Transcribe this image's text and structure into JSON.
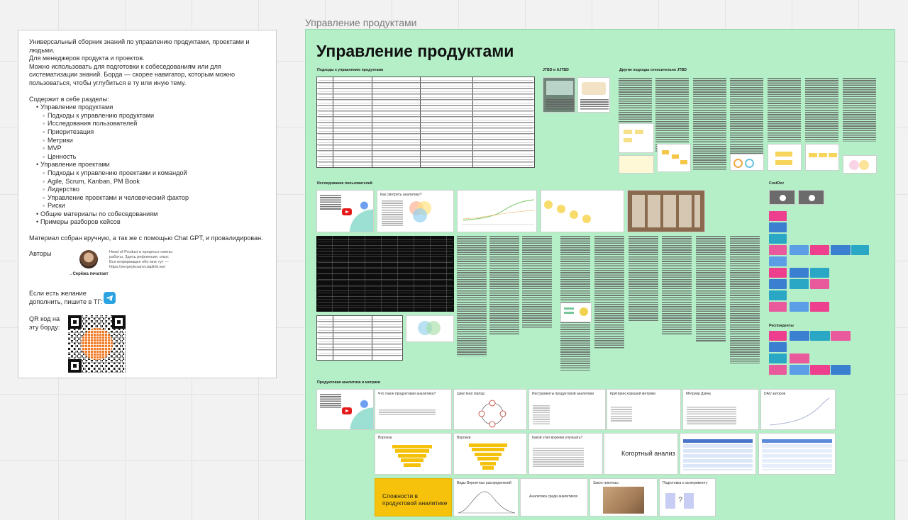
{
  "info": {
    "intro": [
      "Универсальный сборник знаний по управлению продуктами, проектами и людьми.",
      "Для менеджеров продукта и проектов.",
      "Можно использовать для подготовки к собеседованиям или для систематизации знаний. Борда — скорее навигатор, которым можно пользоваться, чтобы углубиться в ту или иную тему."
    ],
    "contains_label": "Содержит в себе разделы:",
    "sections": [
      {
        "level": 1,
        "text": "Управление продуктами"
      },
      {
        "level": 2,
        "text": "Подходы к управлению продуктами"
      },
      {
        "level": 2,
        "text": "Исследования пользователей"
      },
      {
        "level": 2,
        "text": "Приоритезация"
      },
      {
        "level": 2,
        "text": "Метрики"
      },
      {
        "level": 2,
        "text": "MVP"
      },
      {
        "level": 2,
        "text": "Ценность"
      },
      {
        "level": 1,
        "text": "Управление проектами"
      },
      {
        "level": 2,
        "text": "Подходы к управлению проектами и командой"
      },
      {
        "level": 2,
        "text": "Agile, Scrum, Kanban, PM Book"
      },
      {
        "level": 2,
        "text": "Лидерство"
      },
      {
        "level": 2,
        "text": "Управление проектами и человеческий фактор"
      },
      {
        "level": 2,
        "text": "Риски"
      },
      {
        "level": 1,
        "text": "Общие материалы по собеседованиям"
      },
      {
        "level": 1,
        "text": "Примеры разборов кейсов"
      }
    ],
    "collected_note": "Материал собран вручную, а так же с помощью Chat GPT, и провалидирован.",
    "authors_label": "Авторы",
    "author_name": "→Серёжа печатает",
    "author_desc": "Head of Product в процессе смены работы. Здесь рефлексия, опыт. Вся информация обо мне тут — https://sergeytoxarov.taplink.ws/",
    "tg_text": "Если есть желание дополнить, пишите в ТГ:",
    "qr_label": "QR код на эту борду:"
  },
  "board": {
    "label": "Управление продуктами",
    "heading": "Управление продуктами",
    "sections": {
      "approaches": "Подходы к управлению продуктами",
      "jtbd": "JTBD и AJTBD",
      "other_jtbd": "Другие подходы относительно JTBD",
      "research": "Исследования пользователей",
      "custdev": "CustDev",
      "respondents": "Респонденты",
      "analytics": "Продуктовая аналитика и метрики"
    },
    "research_slide_title": "Как смотреть аналитику?",
    "analytics_tiles": [
      {
        "title": "Что такое продуктовая аналитика?"
      },
      {
        "title": "Цикл lean startup"
      },
      {
        "title": "Инструменты продуктовой аналитики"
      },
      {
        "title": "Критерии хорошей метрики"
      },
      {
        "title": "Метрики Дэвча"
      },
      {
        "title": "DAU заторов"
      }
    ],
    "analytics_row2": [
      {
        "title": "Воронка"
      },
      {
        "title": "Воронки"
      },
      {
        "title": "Какой этап воронки улучшать?"
      },
      {
        "title": "Когортный анализ"
      }
    ],
    "analytics_row3": [
      {
        "title": "Сложности в продуктовой аналитике"
      },
      {
        "title": "Виды Вероятных распределений"
      },
      {
        "title": "Аналитика среди аналитиков"
      },
      {
        "title": "Закон гипотезы"
      },
      {
        "title": "Подготовка к эксперименту"
      }
    ]
  }
}
